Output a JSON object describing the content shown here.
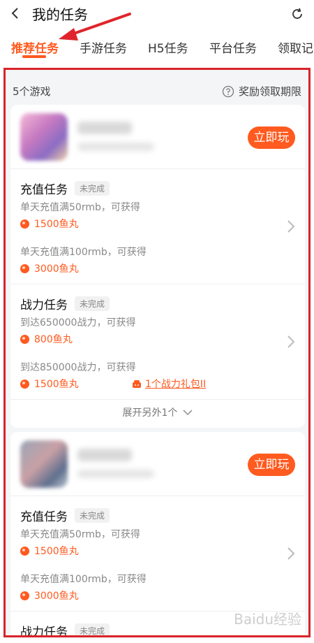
{
  "header": {
    "title": "我的任务"
  },
  "tabs": [
    {
      "label": "推荐任务"
    },
    {
      "label": "手游任务"
    },
    {
      "label": "H5任务"
    },
    {
      "label": "平台任务"
    },
    {
      "label": "领取记"
    }
  ],
  "panel": {
    "games_count": "5个游戏",
    "reward_limit_label": "奖励领取期限"
  },
  "cards": [
    {
      "play_label": "立即玩",
      "tasks": [
        {
          "name": "充值任务",
          "status": "未完成",
          "rewards": [
            {
              "requirement": "单天充值满50rmb，可获得",
              "amount": "1500鱼丸"
            },
            {
              "requirement": "单天充值满100rmb，可获得",
              "amount": "3000鱼丸"
            }
          ]
        },
        {
          "name": "战力任务",
          "status": "未完成",
          "rewards": [
            {
              "requirement": "到达650000战力，可获得",
              "amount": "800鱼丸"
            },
            {
              "requirement": "到达850000战力，可获得",
              "amount": "1500鱼丸",
              "extra": "1个战力礼包II"
            }
          ]
        }
      ],
      "expand_label": "展开另外1个"
    },
    {
      "play_label": "立即玩",
      "tasks": [
        {
          "name": "充值任务",
          "status": "未完成",
          "rewards": [
            {
              "requirement": "单天充值满50rmb，可获得",
              "amount": "1500鱼丸"
            },
            {
              "requirement": "单天充值满100rmb，可获得",
              "amount": "3000鱼丸"
            }
          ]
        },
        {
          "name": "战力任务",
          "status": "未完成",
          "rewards": []
        }
      ]
    }
  ],
  "watermark": "Baidu经验",
  "colors": {
    "accent": "#ff5a1f",
    "highlight_border": "#d8232a",
    "annotation_arrow": "#e0242b"
  },
  "icons": {
    "back": "chevron-left-icon",
    "refresh": "refresh-icon",
    "help": "question-circle-icon",
    "coin": "coin-icon",
    "gift": "gift-icon"
  }
}
